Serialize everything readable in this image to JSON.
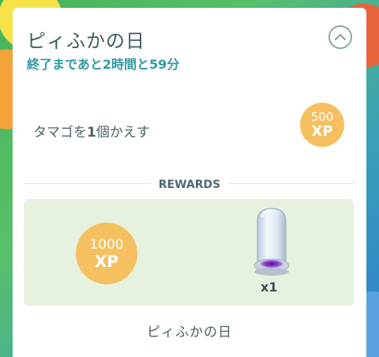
{
  "event": {
    "title": "ピィふかの日",
    "time_remaining": "終了まであと2時間と59分"
  },
  "task": {
    "prefix": "タマゴを",
    "count": "1",
    "suffix": "個かえす",
    "reward_xp": "500",
    "reward_xp_unit": "XP"
  },
  "rewards": {
    "heading": "REWARDS",
    "xp_amount": "1000",
    "xp_unit": "XP",
    "item_icon": "incense-icon",
    "item_quantity": "x1"
  },
  "footer": {
    "label": "ピィふかの日"
  },
  "colors": {
    "title": "#3d5d60",
    "subtitle": "#2f9aa2",
    "xp_badge": "#f5c060",
    "rewards_panel": "#e6f2df"
  }
}
